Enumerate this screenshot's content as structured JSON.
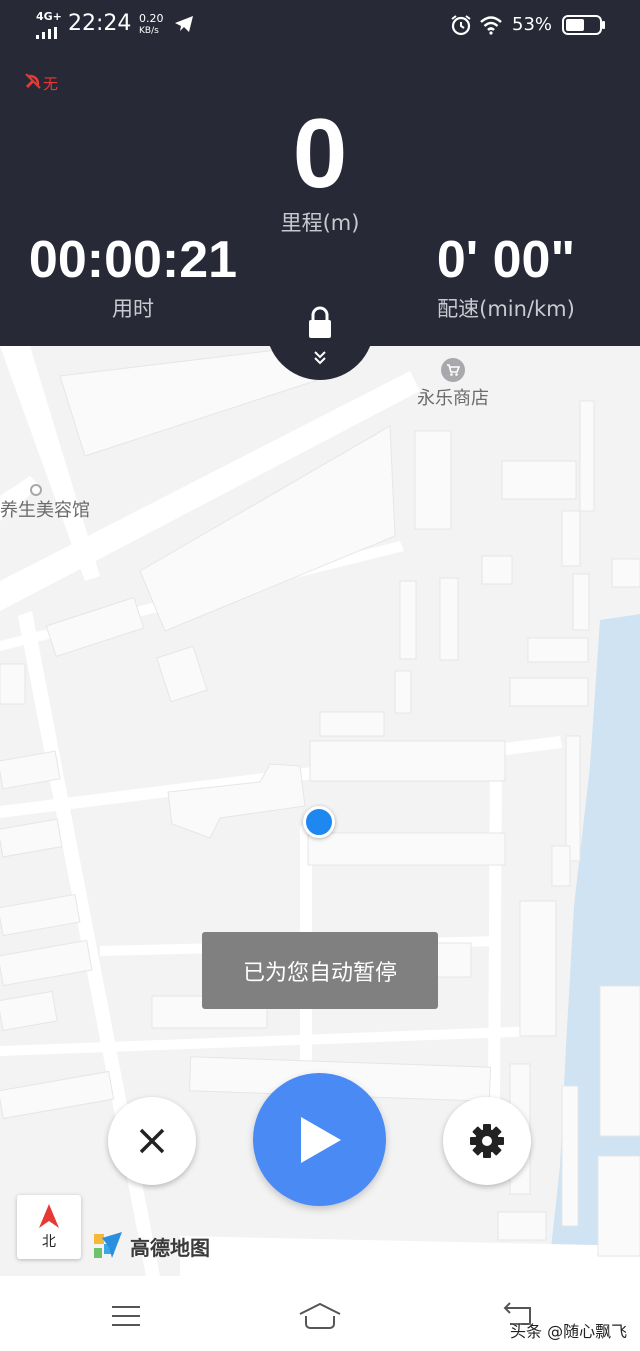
{
  "status_bar": {
    "network": "4G+",
    "time": "22:24",
    "speed_value": "0.20",
    "speed_unit": "KB/s",
    "battery": "53%"
  },
  "gps": {
    "label": "无"
  },
  "stats": {
    "distance_value": "0",
    "distance_label": "里程(m)",
    "duration_value": "00:00:21",
    "duration_label": "用时",
    "pace_value": "0' 00\"",
    "pace_label": "配速(min/km)"
  },
  "map": {
    "poi_shop": "永乐商店",
    "poi_beauty": "养生美容馆",
    "compass_label": "北",
    "provider": "高德地图"
  },
  "toast": {
    "message": "已为您自动暂停"
  },
  "controls": {
    "stop_icon": "close-icon",
    "play_icon": "play-icon",
    "settings_icon": "gear-icon",
    "play_color": "#4a8af4"
  },
  "watermark": {
    "text": "头条 @随心飘飞"
  },
  "colors": {
    "header_bg": "#272a36",
    "accent_blue": "#4a8af4",
    "water": "#cfe3f3",
    "gps_red": "#e53935"
  }
}
